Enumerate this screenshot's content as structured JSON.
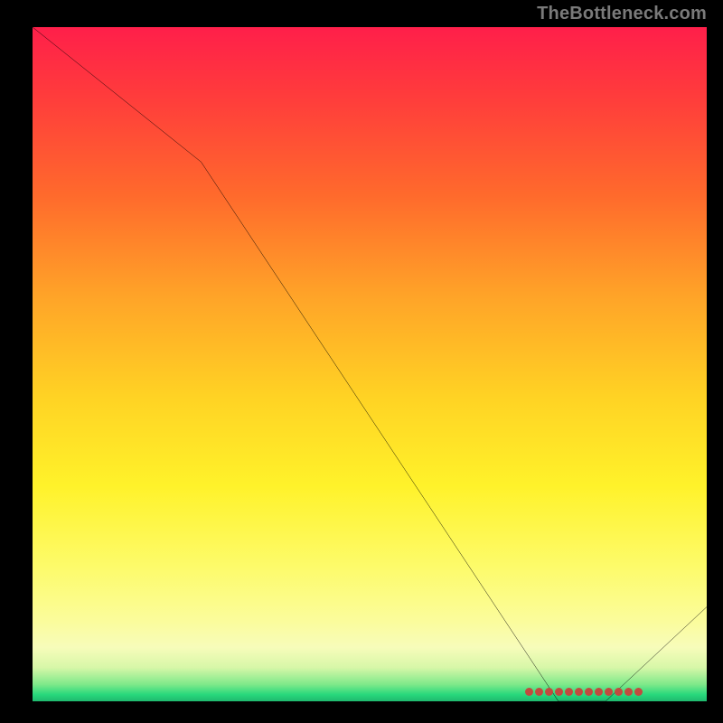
{
  "attribution": "TheBottleneck.com",
  "chart_data": {
    "type": "line",
    "title": "",
    "xlabel": "",
    "ylabel": "",
    "xlim": [
      0,
      100
    ],
    "ylim": [
      0,
      100
    ],
    "grid": false,
    "legend": false,
    "x": [
      0,
      25,
      78,
      85,
      100
    ],
    "values": [
      100,
      80,
      0,
      0,
      14
    ],
    "notes": "Single black curve; vertical gradient red→yellow→green; cluster of ~12 red dots at bottom near x≈74–88 (the zero-bottleneck band)."
  },
  "colors": {
    "background": "#000000",
    "curve": "#000000",
    "attribution_text": "#7a7a7a",
    "marker": "#c24a3f",
    "gradient_stops": [
      "#ff1f4a",
      "#ff3b3c",
      "#ff6a2c",
      "#ffa428",
      "#ffd324",
      "#fff22a",
      "#fdfb6a",
      "#fbfc9b",
      "#f7fcba",
      "#d7f7a8",
      "#7ee98a",
      "#28d87c",
      "#1fb96e"
    ]
  },
  "markers": {
    "count": 12,
    "left_pct": 73
  }
}
